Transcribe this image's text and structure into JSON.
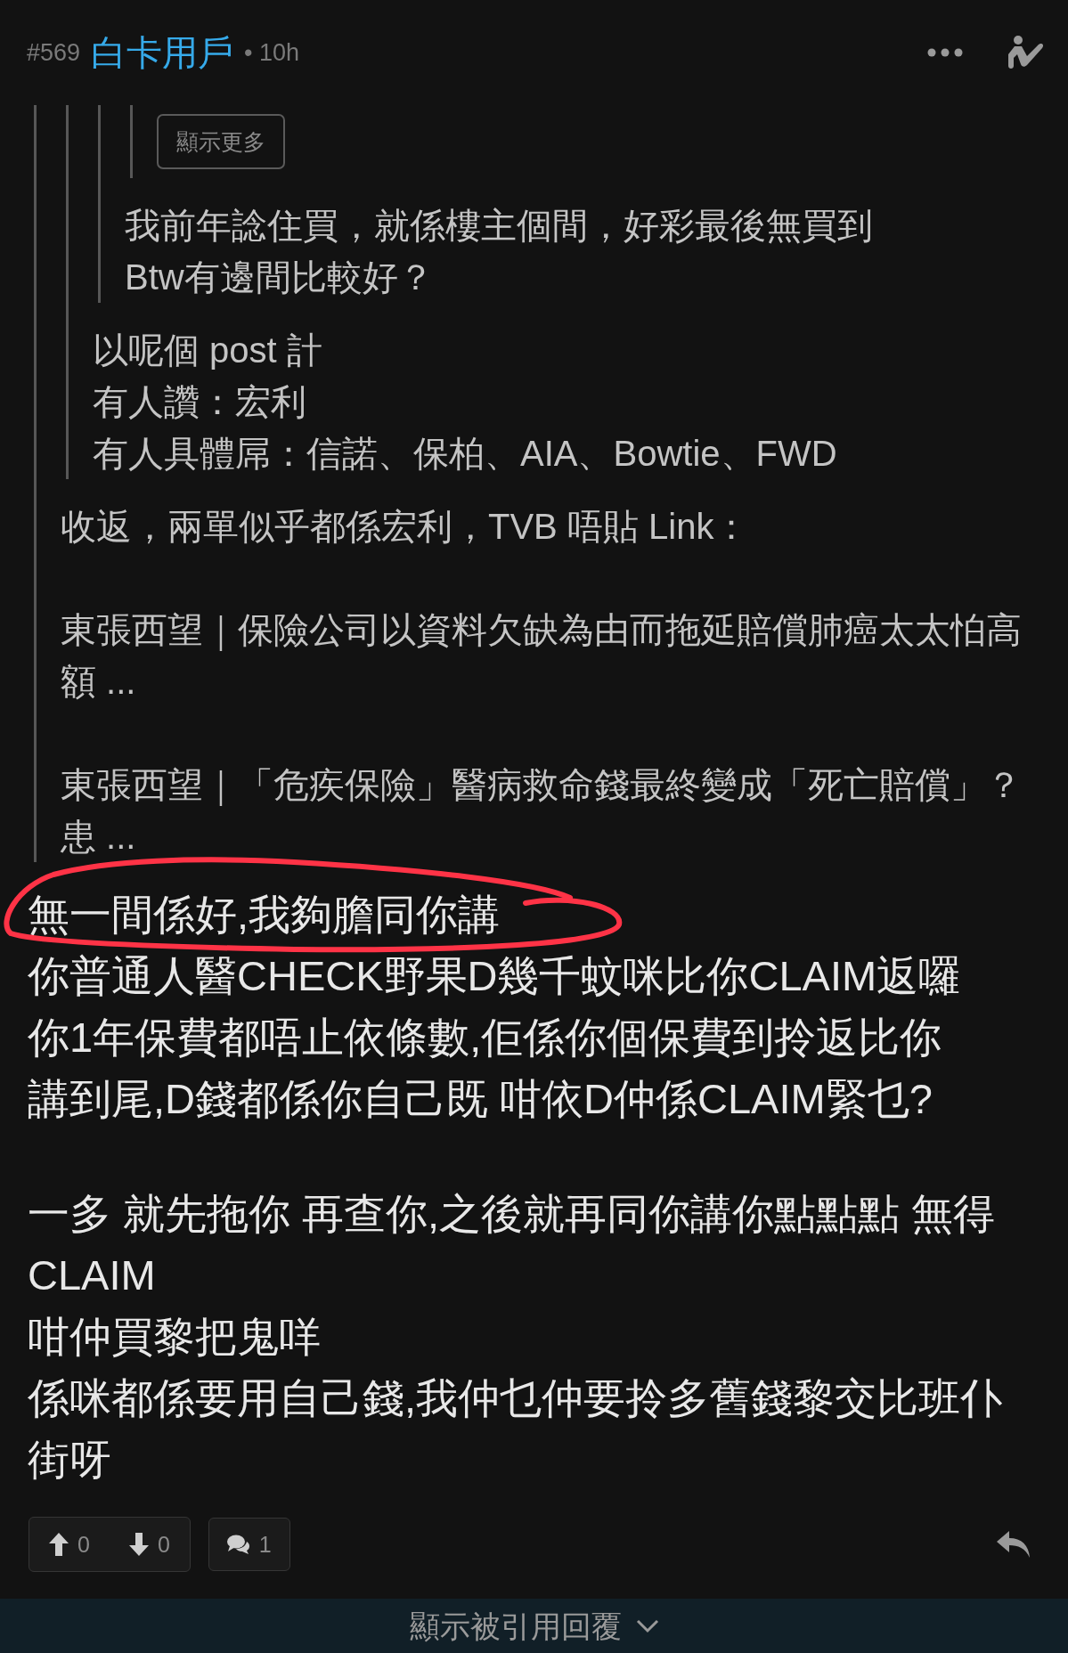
{
  "header": {
    "number": "#569",
    "username": "白卡用戶",
    "age": "• 10h"
  },
  "quote": {
    "quote": {
      "quote": {
        "quote": {
          "show_more_button": "顯示更多"
        },
        "paragraphs": [
          [
            "我前年諗住買，就係樓主個間，好彩最後無買到",
            "Btw有邊間比較好？"
          ]
        ]
      },
      "paragraphs": [
        [
          "以呢個 post 計",
          "有人讚：宏利",
          "有人具體屌：信諾、保柏、AIA、Bowtie、FWD"
        ]
      ]
    },
    "paragraphs": [
      [
        "收返，兩單似乎都係宏利，TVB 唔貼 Link："
      ],
      [
        "東張西望｜保險公司以資料欠缺為由而拖延賠償肺癌太太怕高",
        "額 ..."
      ],
      [
        "東張西望｜「危疾保險」醫病救命錢最終變成「死亡賠償」？",
        "患 ..."
      ]
    ]
  },
  "body": {
    "paragraphs": [
      [
        "無一間係好,我夠膽同你講",
        "你普通人醫CHECK野果D幾千蚊咪比你CLAIM返囉",
        "你1年保費都唔止依條數,佢係你個保費到拎返比你",
        "講到尾,D錢都係你自己既 咁依D仲係CLAIM緊乜?"
      ],
      [
        "一多 就先拖你 再查你,之後就再同你講你點點點 無得",
        "CLAIM",
        "咁仲買黎把鬼咩",
        "係咪都係要用自己錢,我仲乜仲要拎多舊錢黎交比班仆",
        "街呀"
      ]
    ]
  },
  "footer": {
    "upvotes": "0",
    "downvotes": "0",
    "replies": "1"
  },
  "quoted_replies_bar": {
    "label": "顯示被引用回覆"
  }
}
